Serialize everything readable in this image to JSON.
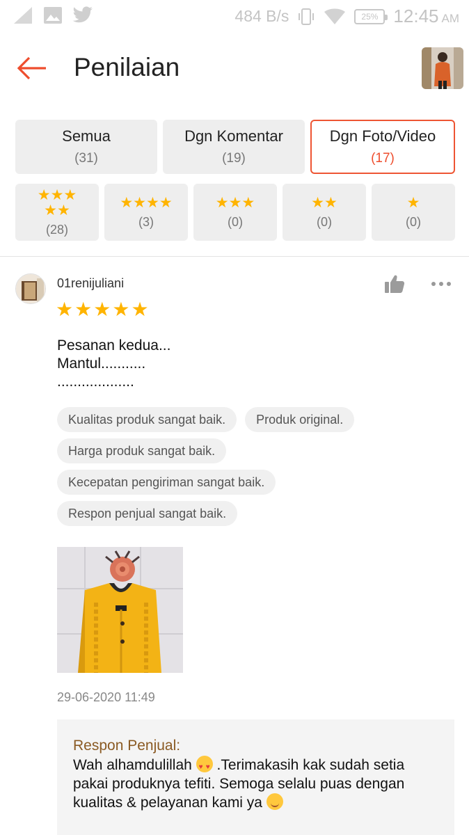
{
  "status_bar": {
    "speed": "484 B/s",
    "battery": "25%",
    "time": "12:45",
    "ampm": "AM"
  },
  "header": {
    "title": "Penilaian"
  },
  "filter_tabs": [
    {
      "label": "Semua",
      "count": "(31)"
    },
    {
      "label": "Dgn Komentar",
      "count": "(19)"
    },
    {
      "label": "Dgn Foto/Video",
      "count": "(17)",
      "active": true
    }
  ],
  "star_tabs": [
    {
      "stars": 5,
      "count": "(28)"
    },
    {
      "stars": 4,
      "count": "(3)"
    },
    {
      "stars": 3,
      "count": "(0)"
    },
    {
      "stars": 2,
      "count": "(0)"
    },
    {
      "stars": 1,
      "count": "(0)"
    }
  ],
  "review": {
    "username": "01renijuliani",
    "rating": 5,
    "text": "Pesanan kedua...\nMantul...........\n...................",
    "tags": [
      "Kualitas produk sangat baik.",
      "Produk original.",
      "Harga produk sangat baik.",
      "Kecepatan pengiriman sangat baik.",
      "Respon penjual sangat baik."
    ],
    "date": "29-06-2020 11:49",
    "seller_response": {
      "label": "Respon Penjual:",
      "text_part1": "Wah alhamdulillah ",
      "text_part2": " .Terimakasih kak sudah setia pakai produknya tefiti. Semoga selalu puas dengan kualitas & pelayanan kami ya "
    }
  },
  "colors": {
    "accent": "#ee4d2d",
    "star": "#ffb400",
    "seller_label": "#8a5a23"
  }
}
